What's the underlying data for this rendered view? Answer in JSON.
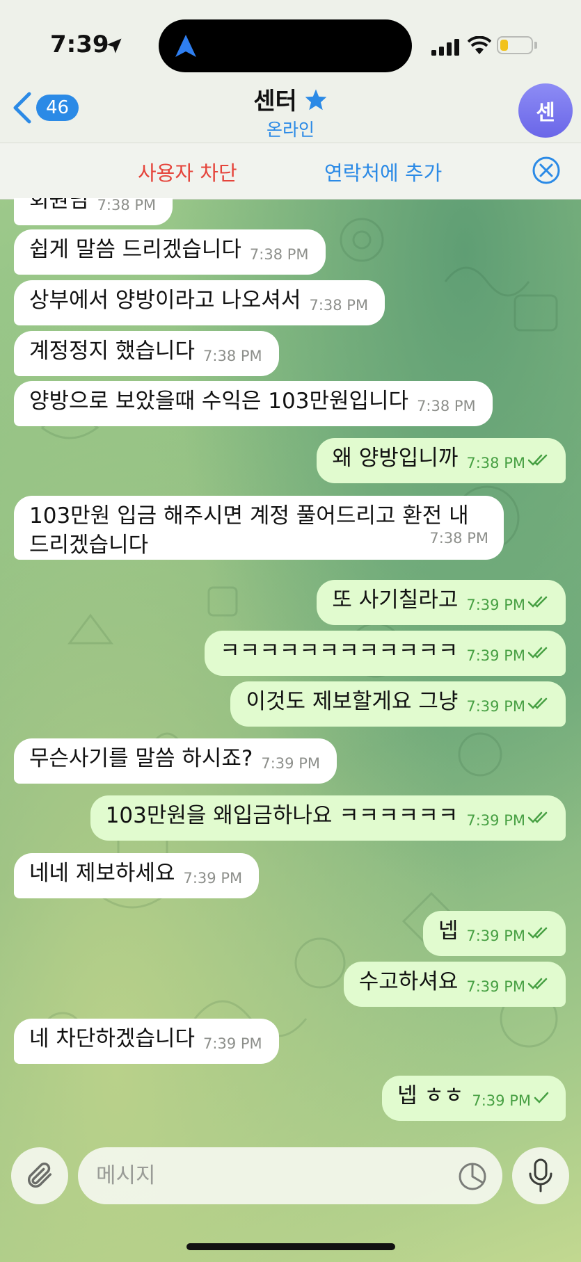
{
  "status_bar": {
    "time": "7:39",
    "battery_level": 0.25
  },
  "header": {
    "back_count": "46",
    "title": "센터",
    "subtitle": "온라인",
    "avatar_text": "센"
  },
  "action_bar": {
    "block_label": "사용자 차단",
    "add_contact_label": "연락처에 추가"
  },
  "messages": [
    {
      "dir": "in",
      "text": "회원님",
      "time": "7:38 PM"
    },
    {
      "dir": "in",
      "text": "쉽게 말씀 드리겠습니다",
      "time": "7:38 PM"
    },
    {
      "dir": "in",
      "text": "상부에서 양방이라고 나오셔서",
      "time": "7:38 PM"
    },
    {
      "dir": "in",
      "text": "계정정지 했습니다",
      "time": "7:38 PM"
    },
    {
      "dir": "in",
      "text": "양방으로 보았을때 수익은 103만원입니다",
      "time": "7:38 PM"
    },
    {
      "dir": "out",
      "text": "왜 양방입니까",
      "time": "7:38 PM",
      "status": "read"
    },
    {
      "dir": "in",
      "text": "103만원 입금 해주시면 계정 풀어드리고 환전 내드리겠습니다",
      "time": "7:38 PM"
    },
    {
      "dir": "out",
      "text": "또 사기칠라고",
      "time": "7:39 PM",
      "status": "read"
    },
    {
      "dir": "out",
      "text": "ㅋㅋㅋㅋㅋㅋㅋㅋㅋㅋㅋㅋ",
      "time": "7:39 PM",
      "status": "read"
    },
    {
      "dir": "out",
      "text": "이것도 제보할게요 그냥",
      "time": "7:39 PM",
      "status": "read"
    },
    {
      "dir": "in",
      "text": "무슨사기를 말씀 하시죠?",
      "time": "7:39 PM"
    },
    {
      "dir": "out",
      "text": "103만원을 왜입금하나요 ㅋㅋㅋㅋㅋㅋ",
      "time": "7:39 PM",
      "status": "read"
    },
    {
      "dir": "in",
      "text": "네네 제보하세요",
      "time": "7:39 PM"
    },
    {
      "dir": "out",
      "text": "넵",
      "time": "7:39 PM",
      "status": "read"
    },
    {
      "dir": "out",
      "text": "수고하셔요",
      "time": "7:39 PM",
      "status": "read"
    },
    {
      "dir": "in",
      "text": "네 차단하겠습니다",
      "time": "7:39 PM"
    },
    {
      "dir": "out",
      "text": "넵 ㅎㅎ",
      "time": "7:39 PM",
      "status": "sent"
    }
  ],
  "composer": {
    "placeholder": "메시지"
  },
  "icons": {
    "back": "chevron-left-icon",
    "star": "star-icon",
    "close": "close-circle-icon",
    "attach": "paperclip-icon",
    "sticker": "sticker-icon",
    "mic": "microphone-icon",
    "read": "double-check-icon",
    "sent": "check-icon"
  },
  "colors": {
    "accent": "#2b8ae6",
    "danger": "#e5443b",
    "outgoing": "#e1fbcf",
    "incoming": "#ffffff",
    "check": "#47a043"
  }
}
